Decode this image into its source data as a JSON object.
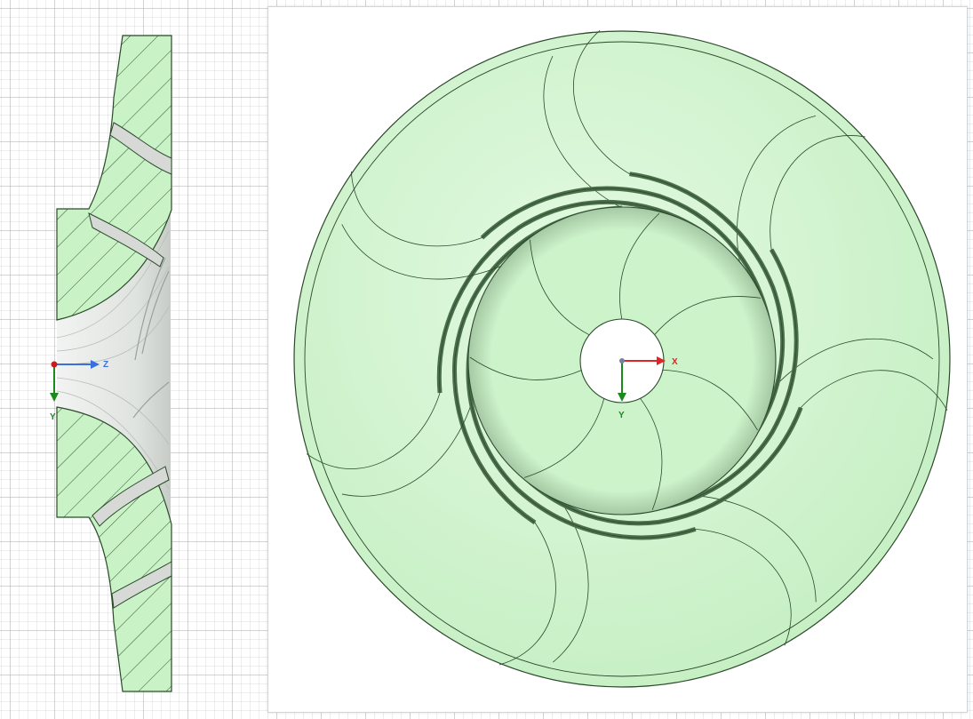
{
  "left_view": {
    "axes": {
      "horizontal": "Z",
      "vertical": "Y"
    },
    "colors": {
      "body_fill": "#c9f2c6",
      "outline": "#2b4a2b",
      "hatch": "#234423",
      "passage": "#d6d9d6"
    }
  },
  "right_view": {
    "axes": {
      "horizontal": "X",
      "vertical": "Y"
    },
    "blade_count": 7,
    "colors": {
      "disk_fill": "#c6f0c4",
      "shroud_fill": "#c2eec1",
      "outline": "#2b4a2b",
      "blade_shadow": "#4b6f4b",
      "hub_hole": "#ffffff"
    }
  },
  "axis_colors": {
    "x": "#e02424",
    "y": "#1a8a1a",
    "z": "#3a6fe0",
    "origin": "#d01818"
  }
}
